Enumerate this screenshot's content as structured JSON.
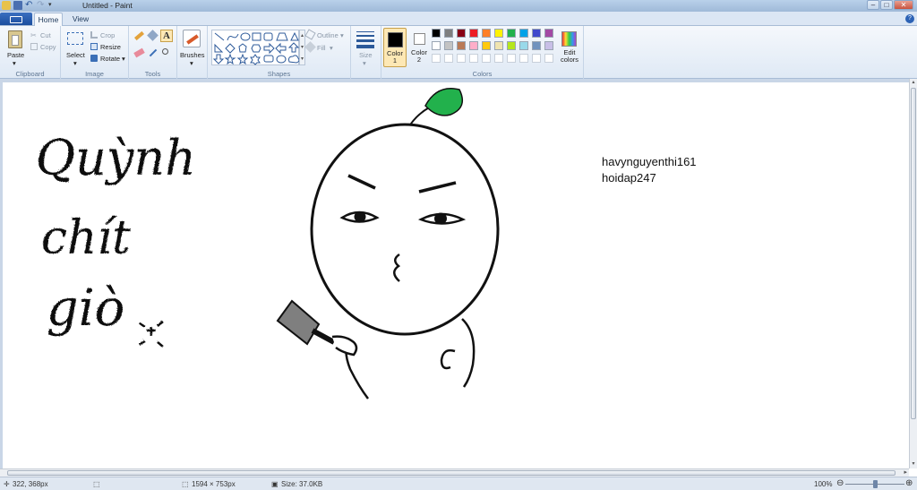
{
  "window": {
    "title": "Untitled - Paint",
    "controls": {
      "minimize": "–",
      "maximize": "□",
      "close": "✕"
    }
  },
  "tabs": [
    {
      "label": "Home",
      "active": true
    },
    {
      "label": "View",
      "active": false
    }
  ],
  "ribbon": {
    "clipboard": {
      "group_label": "Clipboard",
      "paste": "Paste",
      "cut": "Cut",
      "copy": "Copy"
    },
    "image": {
      "group_label": "Image",
      "select": "Select",
      "crop": "Crop",
      "resize": "Resize",
      "rotate": "Rotate"
    },
    "tools": {
      "group_label": "Tools"
    },
    "brushes": {
      "label": "Brushes"
    },
    "shapes": {
      "group_label": "Shapes",
      "outline": "Outline",
      "fill": "Fill"
    },
    "size": {
      "label": "Size"
    },
    "colors": {
      "group_label": "Colors",
      "color1_label": "Color\n1",
      "color2_label": "Color\n2",
      "color1": "#000000",
      "color2": "#ffffff",
      "edit_colors": "Edit\ncolors",
      "palette_row1": [
        "#000000",
        "#7f7f7f",
        "#880015",
        "#ed1c24",
        "#ff7f27",
        "#fff200",
        "#22b14c",
        "#00a2e8",
        "#3f48cc",
        "#a349a4"
      ],
      "palette_row2": [
        "#ffffff",
        "#c3c3c3",
        "#b97a57",
        "#ffaec9",
        "#ffc90e",
        "#efe4b0",
        "#b5e61d",
        "#99d9ea",
        "#7092be",
        "#c8bfe7"
      ]
    }
  },
  "canvas": {
    "handwriting": [
      "Quỳnh",
      "chít",
      "giò"
    ],
    "text_lines": [
      "havynguyenthi161",
      "hoidap247"
    ],
    "leaf_color": "#22b14c"
  },
  "statusbar": {
    "cursor_pos": "322, 368px",
    "image_size": "1594 × 753px",
    "file_size": "Size: 37.0KB",
    "zoom": "100%"
  }
}
